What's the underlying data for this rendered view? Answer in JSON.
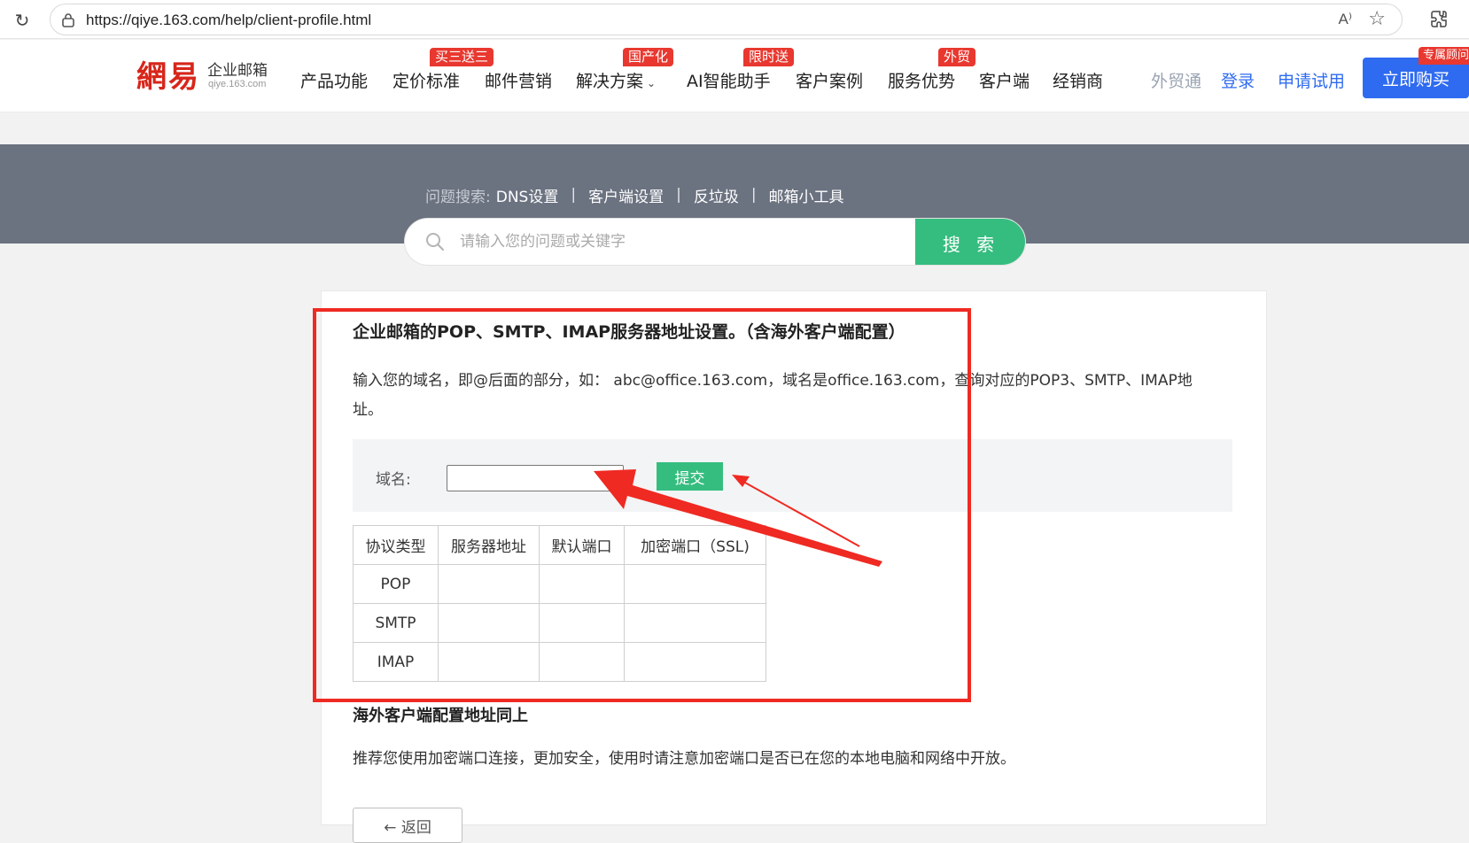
{
  "browser": {
    "url": "https://qiye.163.com/help/client-profile.html",
    "reading_mode_label": "A⁾"
  },
  "header": {
    "logo_mark": "網易",
    "logo_name": "企业邮箱",
    "logo_domain": "qiye.163.com",
    "nav": [
      {
        "label": "产品功能"
      },
      {
        "label": "定价标准",
        "badge": "买三送三"
      },
      {
        "label": "邮件营销"
      },
      {
        "label": "解决方案",
        "badge": "国产化"
      },
      {
        "label": "AI智能助手",
        "badge": "限时送"
      },
      {
        "label": "客户案例"
      },
      {
        "label": "服务优势",
        "badge": "外贸"
      },
      {
        "label": "客户端"
      },
      {
        "label": "经销商"
      }
    ],
    "right_links": {
      "foreign_trade": "外贸通",
      "login": "登录",
      "trial": "申请试用"
    },
    "buy_button": "立即购买",
    "consult_badge": "专属顾问",
    "colors": {
      "brand_red": "#d7261b",
      "badge_red": "#e8382f",
      "link_blue": "#2f6bf0"
    }
  },
  "search": {
    "hot_label": "问题搜索:",
    "hot_links": [
      "DNS设置",
      "客户端设置",
      "反垃圾",
      "邮箱小工具"
    ],
    "placeholder": "请输入您的问题或关键字",
    "button": "搜 索",
    "accent": "#35bd7f"
  },
  "article": {
    "title": "企业邮箱的POP、SMTP、IMAP服务器地址设置。（含海外客户端配置）",
    "intro": "输入您的域名，即@后面的部分，如：  abc@office.163.com，域名是office.163.com，查询对应的POP3、SMTP、IMAP地址。",
    "domain_label": "域名:",
    "domain_value": "",
    "submit": "提交",
    "table": {
      "headers": [
        "协议类型",
        "服务器地址",
        "默认端口",
        "加密端口（SSL)"
      ],
      "rows": [
        [
          "POP",
          "",
          "",
          ""
        ],
        [
          "SMTP",
          "",
          "",
          ""
        ],
        [
          "IMAP",
          "",
          "",
          ""
        ]
      ]
    },
    "overseas_title": "海外客户端配置地址同上",
    "recommend": "推荐您使用加密端口连接，更加安全，使用时请注意加密端口是否已在您的本地电脑和网络中开放。",
    "back": "← 返回"
  },
  "annotation": {
    "color": "#ef2a22"
  }
}
